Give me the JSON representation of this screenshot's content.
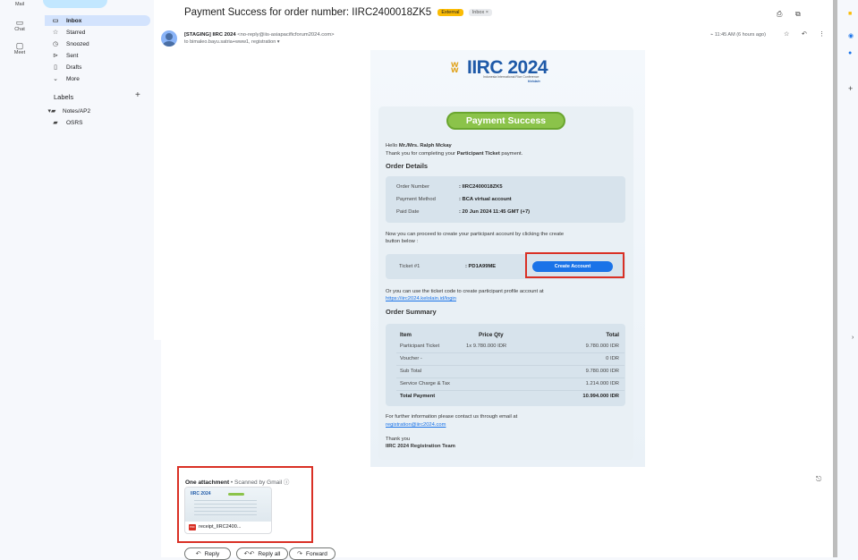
{
  "rail": {
    "mail_label": "Mail",
    "chat_label": "Chat",
    "meet_label": "Meet"
  },
  "nav": {
    "items": [
      {
        "label": "Inbox",
        "icon": "inbox-icon",
        "active": true
      },
      {
        "label": "Starred",
        "icon": "star-icon"
      },
      {
        "label": "Snoozed",
        "icon": "clock-icon"
      },
      {
        "label": "Sent",
        "icon": "send-icon"
      },
      {
        "label": "Drafts",
        "icon": "draft-icon"
      },
      {
        "label": "More",
        "icon": "chevron-down-icon"
      }
    ],
    "labels_heading": "Labels",
    "labels": [
      {
        "label": "Notes/AP2"
      },
      {
        "label": "OSRS"
      }
    ]
  },
  "email": {
    "subject": "Payment Success for order number: IIRC2400018ZK5",
    "tag_external": "External",
    "tag_inbox": "Inbox ×",
    "sender_name": "[STAGING] IIRC 2024",
    "sender_address": "<no-reply@iis-asiapacificforum2024.com>",
    "to_line": "to bimaleo.bayu.satria+www1, registration",
    "time": "11:45 AM (6 hours ago)"
  },
  "body": {
    "logo_text": "IIRC 2024",
    "logo_sub": "Indonesia International Rice Conference",
    "logo_by": "Kelolain",
    "badge": "Payment Success",
    "greeting_prefix": "Hello ",
    "greeting_name": "Mr./Mrs. Ralph Mckay",
    "thanks_prefix": "Thank you for completing your ",
    "thanks_bold": "Participant Ticket",
    "thanks_suffix": " payment.",
    "order_details_heading": "Order Details",
    "order_details": [
      {
        "label": "Order Number",
        "value": ": IIRC2400018ZK5"
      },
      {
        "label": "Payment Method",
        "value": ": BCA virtual account"
      },
      {
        "label": "Paid Date",
        "value": ": 20 Jun 2024 11:45 GMT (+7)"
      }
    ],
    "proceed_line1": "Now you can proceed to create your participant account by clicking the create",
    "proceed_line2": "button below :",
    "ticket_label": "Ticket #1",
    "ticket_code": ": PD1A99ME",
    "create_account": "Create Account",
    "alt_line": "Or you can use the ticket code to create participant profile account at",
    "alt_link": "https://iirc2024.kelolain.id/login",
    "summary_heading": "Order Summary",
    "summary_head": {
      "item": "Item",
      "price_qty": "Price Qty",
      "total": "Total"
    },
    "summary_rows": [
      {
        "item": "Participant Ticket",
        "price_qty": "1x 9.780.000 IDR",
        "total": "9.780.000 IDR"
      },
      {
        "item": "Voucher -",
        "price_qty": "",
        "total": "0 IDR"
      },
      {
        "item": "Sub Total",
        "price_qty": "",
        "total": "9.780.000 IDR"
      },
      {
        "item": "Service Charge & Tax",
        "price_qty": "",
        "total": "1.214.000 IDR"
      }
    ],
    "summary_total": {
      "item": "Total Payment",
      "total": "10.994.000 IDR"
    },
    "contact_line": "For further information please contact us through email at",
    "contact_email": "registration@iirc2024.com",
    "signoff": "Thank you",
    "team": "IIRC 2024 Registration Team"
  },
  "attachment": {
    "title": "One attachment",
    "scanned": " • Scanned by Gmail ⓘ",
    "filename": "receipt_IIRC2400...",
    "thumb_logo": "IIRC 2024"
  },
  "actions": {
    "reply": "Reply",
    "reply_all": "Reply all",
    "forward": "Forward"
  },
  "colors": {
    "accent": "#1a73e8",
    "success": "#8bc34a",
    "highlight_border": "#d93025",
    "external_tag": "#fbbc04"
  }
}
